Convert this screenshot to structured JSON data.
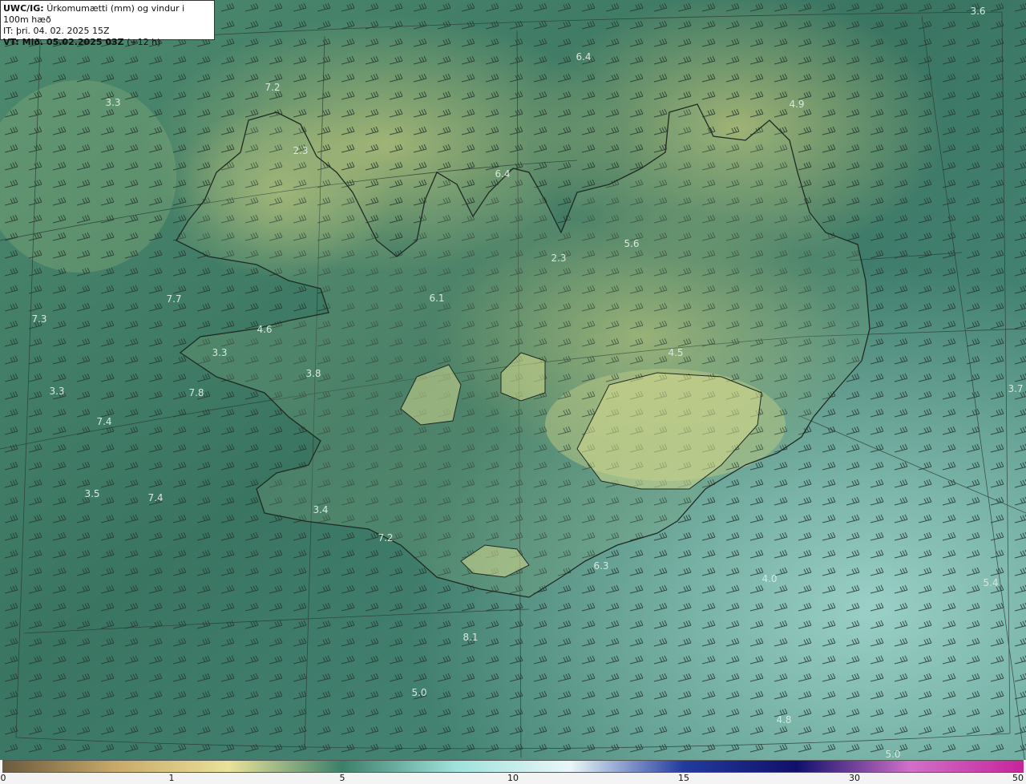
{
  "header": {
    "model": "UWC/IG:",
    "title": "Úrkomumætti (mm) og vindur i 100m hæð",
    "it_label": "IT:",
    "it_value": "þri. 04. 02. 2025 15Z",
    "vt_label": "VT: Mið. 05.02.2025 03Z",
    "vt_offset": "(+12 h)"
  },
  "colorbar": {
    "ticks": [
      "0",
      "1",
      "5",
      "10",
      "15",
      "30",
      "50"
    ],
    "colors": [
      "#6b5a3e",
      "#c8a96a",
      "#e9e29a",
      "#3c7f6a",
      "#9fe2dc",
      "#e9f7f8",
      "#223b9e",
      "#10106a",
      "#d070c8",
      "#c7249a"
    ]
  },
  "map_labels": [
    {
      "text": "3.6"
    },
    {
      "text": "6.4"
    },
    {
      "text": "7.2"
    },
    {
      "text": "3.3"
    },
    {
      "text": "4.9"
    },
    {
      "text": "2.3"
    },
    {
      "text": "6.4"
    },
    {
      "text": "5.6"
    },
    {
      "text": "2.3"
    },
    {
      "text": "6.1"
    },
    {
      "text": "7.7"
    },
    {
      "text": "7.3"
    },
    {
      "text": "4.6"
    },
    {
      "text": "3.3"
    },
    {
      "text": "4.5"
    },
    {
      "text": "3.8"
    },
    {
      "text": "3.3"
    },
    {
      "text": "7.8"
    },
    {
      "text": "3.7"
    },
    {
      "text": "7.4"
    },
    {
      "text": "3.5"
    },
    {
      "text": "7.4"
    },
    {
      "text": "3.4"
    },
    {
      "text": "7.2"
    },
    {
      "text": "6.3"
    },
    {
      "text": "4.0"
    },
    {
      "text": "5.4"
    },
    {
      "text": "8.1"
    },
    {
      "text": "5.0"
    },
    {
      "text": "4.8"
    },
    {
      "text": "5.0"
    }
  ]
}
